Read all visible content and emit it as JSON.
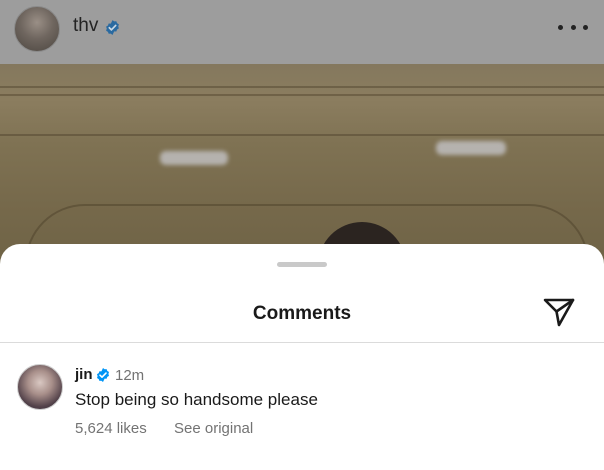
{
  "post": {
    "username": "thv",
    "verified_icon": "verified-badge-icon",
    "more_icon": "more-options-icon"
  },
  "sheet": {
    "title": "Comments",
    "share_icon": "send-icon"
  },
  "comments": [
    {
      "username": "jin",
      "time": "12m",
      "text": "Stop being so handsome please",
      "likes": "5,624 likes",
      "see_original": "See original"
    }
  ],
  "colors": {
    "verified": "#0095f6",
    "secondary_text": "#737373",
    "primary_text": "#1a1a1a"
  }
}
